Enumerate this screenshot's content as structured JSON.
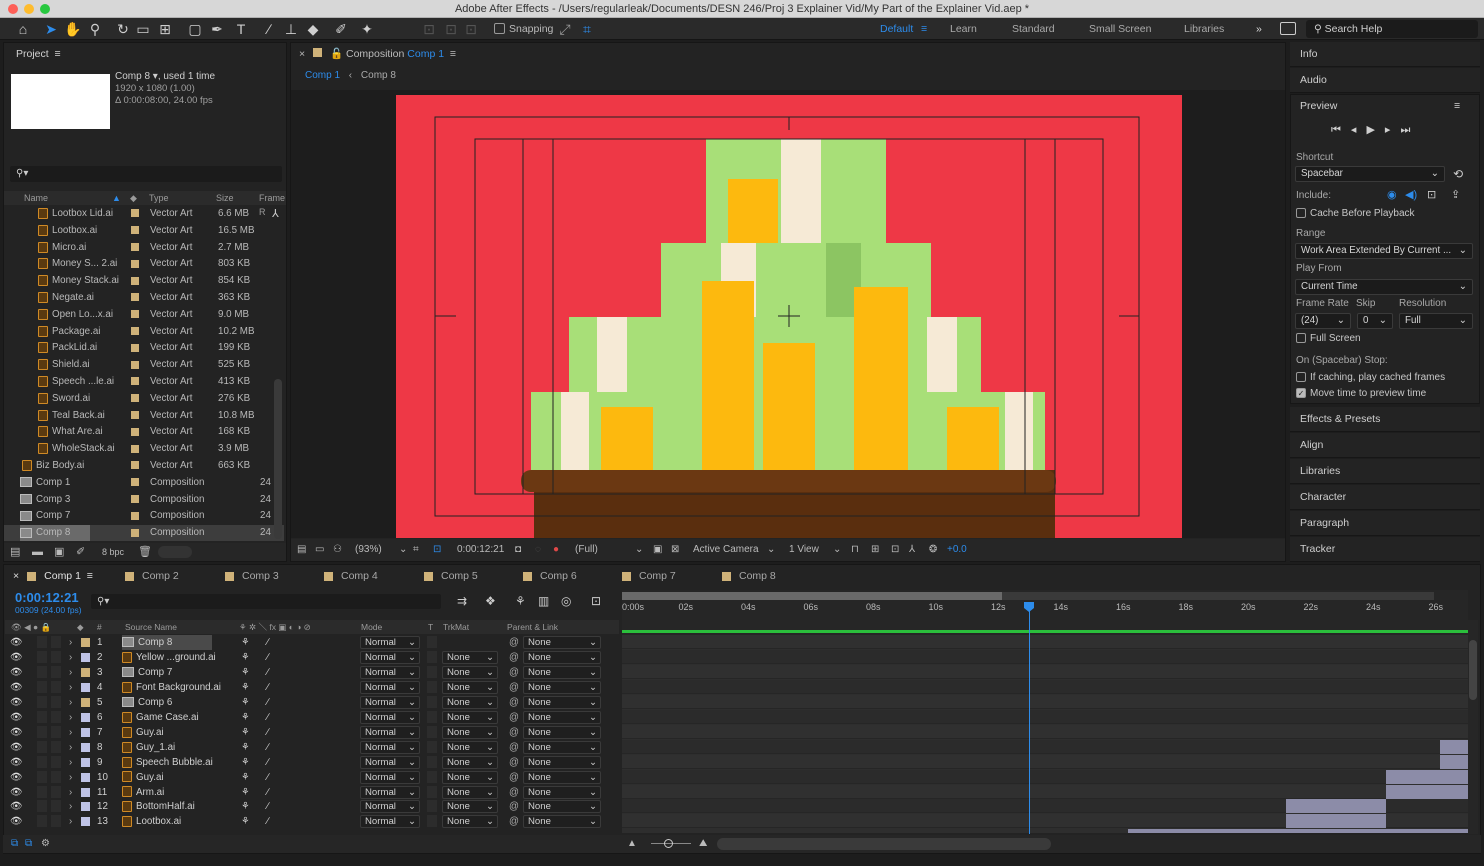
{
  "window": {
    "title": "Adobe After Effects - /Users/regularleak/Documents/DESN 246/Proj 3 Explainer Vid/My Part of the Explainer Vid.aep *"
  },
  "toolbar": {
    "snapping": "Snapping",
    "workspaces": [
      "Default",
      "Learn",
      "Standard",
      "Small Screen",
      "Libraries"
    ],
    "more": "»",
    "search_placeholder": "Search Help"
  },
  "project": {
    "title": "Project",
    "selected_name": "Comp 8 ▾",
    "used": ", used 1 time",
    "info1": "1920 x 1080 (1.00)",
    "info2": "Δ 0:00:08:00, 24.00 fps",
    "search_glyph": "⚲▾",
    "columns": {
      "name": "Name",
      "type": "Type",
      "size": "Size",
      "frame": "Frame R"
    },
    "items": [
      {
        "name": "Lootbox Lid.ai",
        "type": "Vector Art",
        "size": "6.6 MB"
      },
      {
        "name": "Lootbox.ai",
        "type": "Vector Art",
        "size": "16.5 MB"
      },
      {
        "name": "Micro.ai",
        "type": "Vector Art",
        "size": "2.7 MB"
      },
      {
        "name": "Money S... 2.ai",
        "type": "Vector Art",
        "size": "803 KB"
      },
      {
        "name": "Money Stack.ai",
        "type": "Vector Art",
        "size": "854 KB"
      },
      {
        "name": "Negate.ai",
        "type": "Vector Art",
        "size": "363 KB"
      },
      {
        "name": "Open Lo...x.ai",
        "type": "Vector Art",
        "size": "9.0 MB"
      },
      {
        "name": "Package.ai",
        "type": "Vector Art",
        "size": "10.2 MB"
      },
      {
        "name": "PackLid.ai",
        "type": "Vector Art",
        "size": "199 KB"
      },
      {
        "name": "Shield.ai",
        "type": "Vector Art",
        "size": "525 KB"
      },
      {
        "name": "Speech ...le.ai",
        "type": "Vector Art",
        "size": "413 KB"
      },
      {
        "name": "Sword.ai",
        "type": "Vector Art",
        "size": "276 KB"
      },
      {
        "name": "Teal Back.ai",
        "type": "Vector Art",
        "size": "10.8 MB"
      },
      {
        "name": "What Are.ai",
        "type": "Vector Art",
        "size": "168 KB"
      },
      {
        "name": "WholeStack.ai",
        "type": "Vector Art",
        "size": "3.9 MB"
      }
    ],
    "items2": [
      {
        "name": "Biz Body.ai",
        "type": "Vector Art",
        "size": "663 KB"
      }
    ],
    "comps": [
      {
        "name": "Comp 1",
        "type": "Composition",
        "fps": "24"
      },
      {
        "name": "Comp 3",
        "type": "Composition",
        "fps": "24"
      },
      {
        "name": "Comp 7",
        "type": "Composition",
        "fps": "24"
      },
      {
        "name": "Comp 8",
        "type": "Composition",
        "fps": "24"
      }
    ],
    "bpc": "8 bpc"
  },
  "viewer": {
    "panel_label": "Composition",
    "panel_comp": "Comp 1",
    "crumb1": "Comp 1",
    "crumb2": "Comp 8",
    "zoom": "(93%)",
    "timecode": "0:00:12:21",
    "resolution": "(Full)",
    "camera": "Active Camera",
    "views": "1 View",
    "exposure": "+0.0"
  },
  "right": {
    "info": "Info",
    "audio": "Audio",
    "preview": "Preview",
    "shortcut_label": "Shortcut",
    "shortcut": "Spacebar",
    "include": "Include:",
    "cache": "Cache Before Playback",
    "range_label": "Range",
    "range": "Work Area Extended By Current ...",
    "playfrom_label": "Play From",
    "playfrom": "Current Time",
    "framerate_label": "Frame Rate",
    "skip_label": "Skip",
    "resolution_label": "Resolution",
    "framerate": "(24)",
    "skip": "0",
    "resolution": "Full",
    "fullscreen": "Full Screen",
    "stop_label": "On (Spacebar) Stop:",
    "stop1": "If caching, play cached frames",
    "stop2": "Move time to preview time",
    "panels": [
      "Effects & Presets",
      "Align",
      "Libraries",
      "Character",
      "Paragraph",
      "Tracker"
    ]
  },
  "timeline": {
    "tabs": [
      "Comp 1",
      "Comp 2",
      "Comp 3",
      "Comp 4",
      "Comp 5",
      "Comp 6",
      "Comp 7",
      "Comp 8"
    ],
    "timecode": "0:00:12:21",
    "frames": "00309 (24.00 fps)",
    "search_glyph": "⚲▾",
    "headers": {
      "num": "#",
      "source": "Source Name",
      "mode": "Mode",
      "t": "T",
      "trkmat": "TrkMat",
      "parent": "Parent & Link"
    },
    "ruler": [
      "0:00s",
      "02s",
      "04s",
      "06s",
      "08s",
      "10s",
      "12s",
      "14s",
      "16s",
      "18s",
      "20s",
      "22s",
      "24s",
      "26s"
    ],
    "layers": [
      {
        "num": "1",
        "name": "Comp 8",
        "mode": "Normal",
        "trkmat": "",
        "parent": "None",
        "comp": true
      },
      {
        "num": "2",
        "name": "Yellow ...ground.ai",
        "mode": "Normal",
        "trkmat": "None",
        "parent": "None",
        "comp": false
      },
      {
        "num": "3",
        "name": "Comp 7",
        "mode": "Normal",
        "trkmat": "None",
        "parent": "None",
        "comp": true
      },
      {
        "num": "4",
        "name": "Font Background.ai",
        "mode": "Normal",
        "trkmat": "None",
        "parent": "None",
        "comp": false
      },
      {
        "num": "5",
        "name": "Comp 6",
        "mode": "Normal",
        "trkmat": "None",
        "parent": "None",
        "comp": true
      },
      {
        "num": "6",
        "name": "Game Case.ai",
        "mode": "Normal",
        "trkmat": "None",
        "parent": "None",
        "comp": false
      },
      {
        "num": "7",
        "name": "Guy.ai",
        "mode": "Normal",
        "trkmat": "None",
        "parent": "None",
        "comp": false
      },
      {
        "num": "8",
        "name": "Guy_1.ai",
        "mode": "Normal",
        "trkmat": "None",
        "parent": "None",
        "comp": false
      },
      {
        "num": "9",
        "name": "Speech Bubble.ai",
        "mode": "Normal",
        "trkmat": "None",
        "parent": "None",
        "comp": false
      },
      {
        "num": "10",
        "name": "Guy.ai",
        "mode": "Normal",
        "trkmat": "None",
        "parent": "None",
        "comp": false
      },
      {
        "num": "11",
        "name": "Arm.ai",
        "mode": "Normal",
        "trkmat": "None",
        "parent": "None",
        "comp": false
      },
      {
        "num": "12",
        "name": "BottomHalf.ai",
        "mode": "Normal",
        "trkmat": "None",
        "parent": "None",
        "comp": false
      },
      {
        "num": "13",
        "name": "Lootbox.ai",
        "mode": "Normal",
        "trkmat": "None",
        "parent": "None",
        "comp": false
      }
    ]
  },
  "colors": {
    "accent": "#2d8ceb",
    "canvas_red": "#ee3846",
    "green": "#a8df78",
    "gold": "#fdb90e",
    "cream": "#f6ead6",
    "brown": "#6b3812"
  }
}
